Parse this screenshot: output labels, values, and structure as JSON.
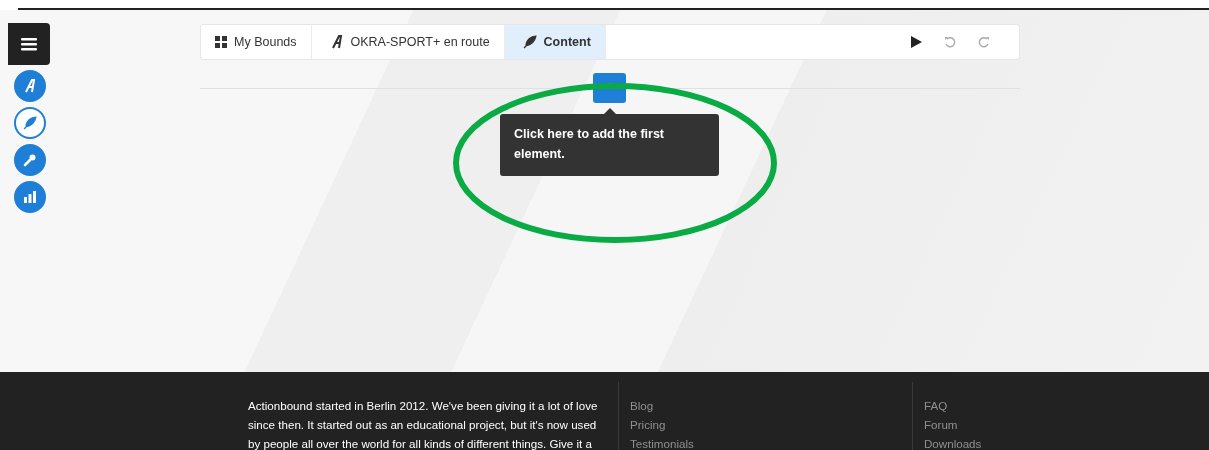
{
  "sidebar": {
    "items": [
      {
        "kind": "logo",
        "selected": false
      },
      {
        "kind": "feather",
        "selected": true
      },
      {
        "kind": "wrench",
        "selected": false
      },
      {
        "kind": "chart",
        "selected": false
      }
    ]
  },
  "breadcrumb": [
    {
      "kind": "grid",
      "label": "My Bounds",
      "selected": false
    },
    {
      "kind": "logo",
      "label": "OKRA-SPORT+ en route",
      "selected": false
    },
    {
      "kind": "feather",
      "label": "Content",
      "selected": true
    }
  ],
  "toolbar": [
    {
      "kind": "play",
      "disabled": false
    },
    {
      "kind": "undo",
      "disabled": true
    },
    {
      "kind": "redo",
      "disabled": true
    }
  ],
  "tooltip": {
    "text": "Click here to add the first element."
  },
  "footer": {
    "about": "Actionbound started in Berlin 2012. We've been giving it a lot of love since then. It started out as an educational project, but it's now used by people all over the world for all kinds of different things. Give it a",
    "columns": [
      [
        "Blog",
        "Pricing",
        "Testimonials"
      ],
      [
        "FAQ",
        "Forum",
        "Downloads"
      ]
    ]
  }
}
